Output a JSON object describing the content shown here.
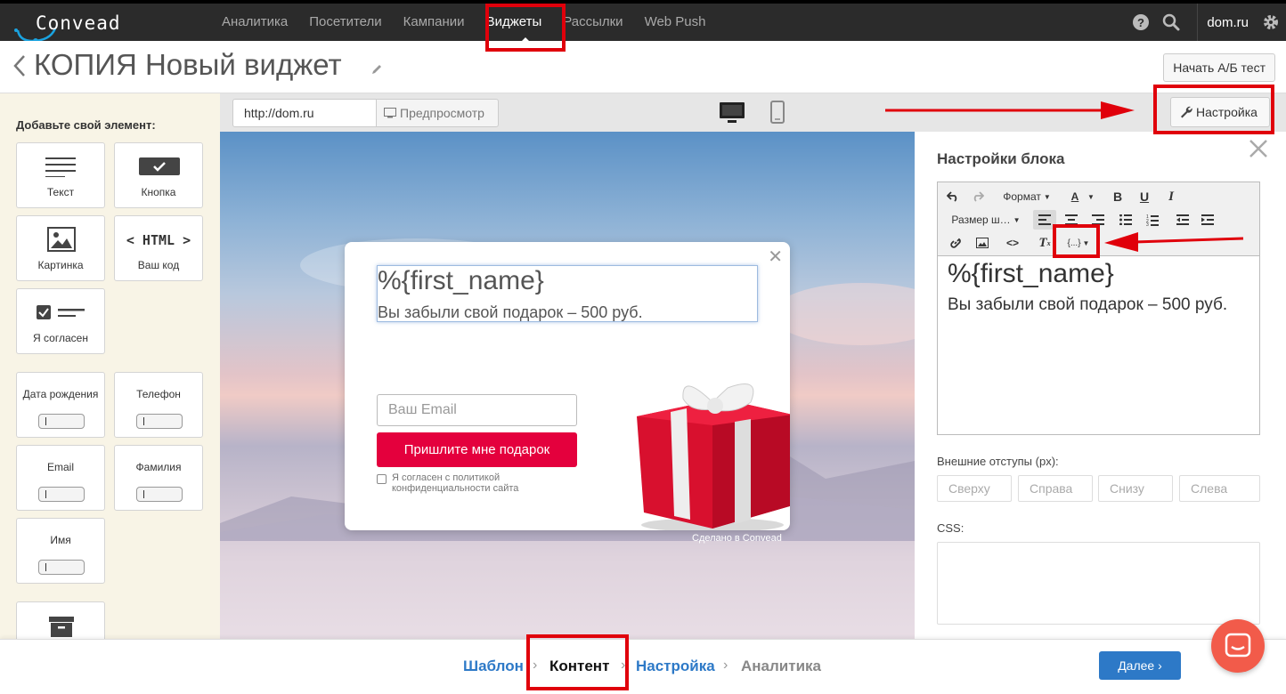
{
  "app": {
    "logo_text": "Convead",
    "account": "dom.ru"
  },
  "nav": {
    "items": [
      "Аналитика",
      "Посетители",
      "Кампании",
      "Виджеты",
      "Рассылки",
      "Web Push"
    ],
    "active": "Виджеты"
  },
  "title": {
    "text": "КОПИЯ Новый виджет",
    "ab_test_button": "Начать А/Б тест"
  },
  "toolbar": {
    "url": "http://dom.ru",
    "preview_label": "Предпросмотр",
    "settings_label": "Настройка"
  },
  "sidebar": {
    "title": "Добавьте свой элемент:",
    "elements": [
      {
        "label": "Текст",
        "icon": "text-lines-icon"
      },
      {
        "label": "Кнопка",
        "icon": "button-check-icon"
      },
      {
        "label": "Картинка",
        "icon": "image-icon"
      },
      {
        "label": "Ваш код",
        "icon": "html-icon",
        "icon_text": "< HTML >"
      },
      {
        "label": "Я согласен",
        "icon": "checkbox-icon"
      }
    ],
    "fields": [
      "Дата рождения",
      "Телефон",
      "Email",
      "Фамилия",
      "Имя"
    ]
  },
  "popup": {
    "heading": "%{first_name}",
    "subheading": "Вы забыли свой подарок – 500 руб.",
    "email_placeholder": "Ваш Email",
    "cta": "Пришлите мне подарок",
    "consent": "Я согласен с политикой конфиденциальности сайта",
    "made_by": "Сделано в Convead"
  },
  "panel": {
    "title": "Настройки блока",
    "format_dropdown": "Формат",
    "size_dropdown": "Размер ш…",
    "variables_button": "{...}",
    "editor_heading": "%{first_name}",
    "editor_text": "Вы забыли свой подарок – 500 руб.",
    "margins_label": "Внешние отступы (px):",
    "margins": [
      "Сверху",
      "Справа",
      "Снизу",
      "Слева"
    ],
    "css_label": "CSS:"
  },
  "wizard": {
    "steps": [
      "Шаблон",
      "Контент",
      "Настройка",
      "Аналитика"
    ],
    "active": "Контент",
    "next_button": "Далее"
  },
  "colors": {
    "accent": "#e4003d",
    "link": "#2d79c7",
    "annotation": "#e0000b",
    "chat": "#f25b4a"
  }
}
